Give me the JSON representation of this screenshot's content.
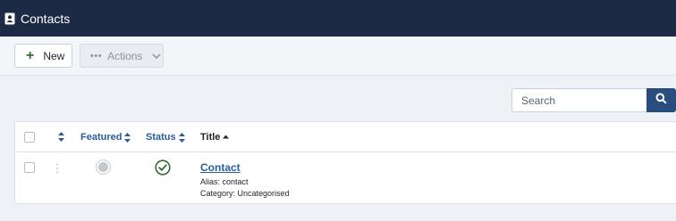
{
  "header": {
    "title": "Contacts",
    "icon": "address-book-icon"
  },
  "toolbar": {
    "new_label": "New",
    "actions_label": "Actions",
    "actions_dots": "•••"
  },
  "search": {
    "placeholder": "Search",
    "value": ""
  },
  "table": {
    "columns": {
      "featured": "Featured",
      "status": "Status",
      "title": "Title"
    },
    "rows": [
      {
        "title": "Contact",
        "alias": "Alias: contact",
        "category": "Category: Uncategorised",
        "featured": false,
        "published": true
      }
    ]
  },
  "colors": {
    "header_bg": "#1c2a45",
    "link": "#2a5c9a",
    "published_green": "#2e6b34",
    "search_button": "#2a4d80"
  }
}
